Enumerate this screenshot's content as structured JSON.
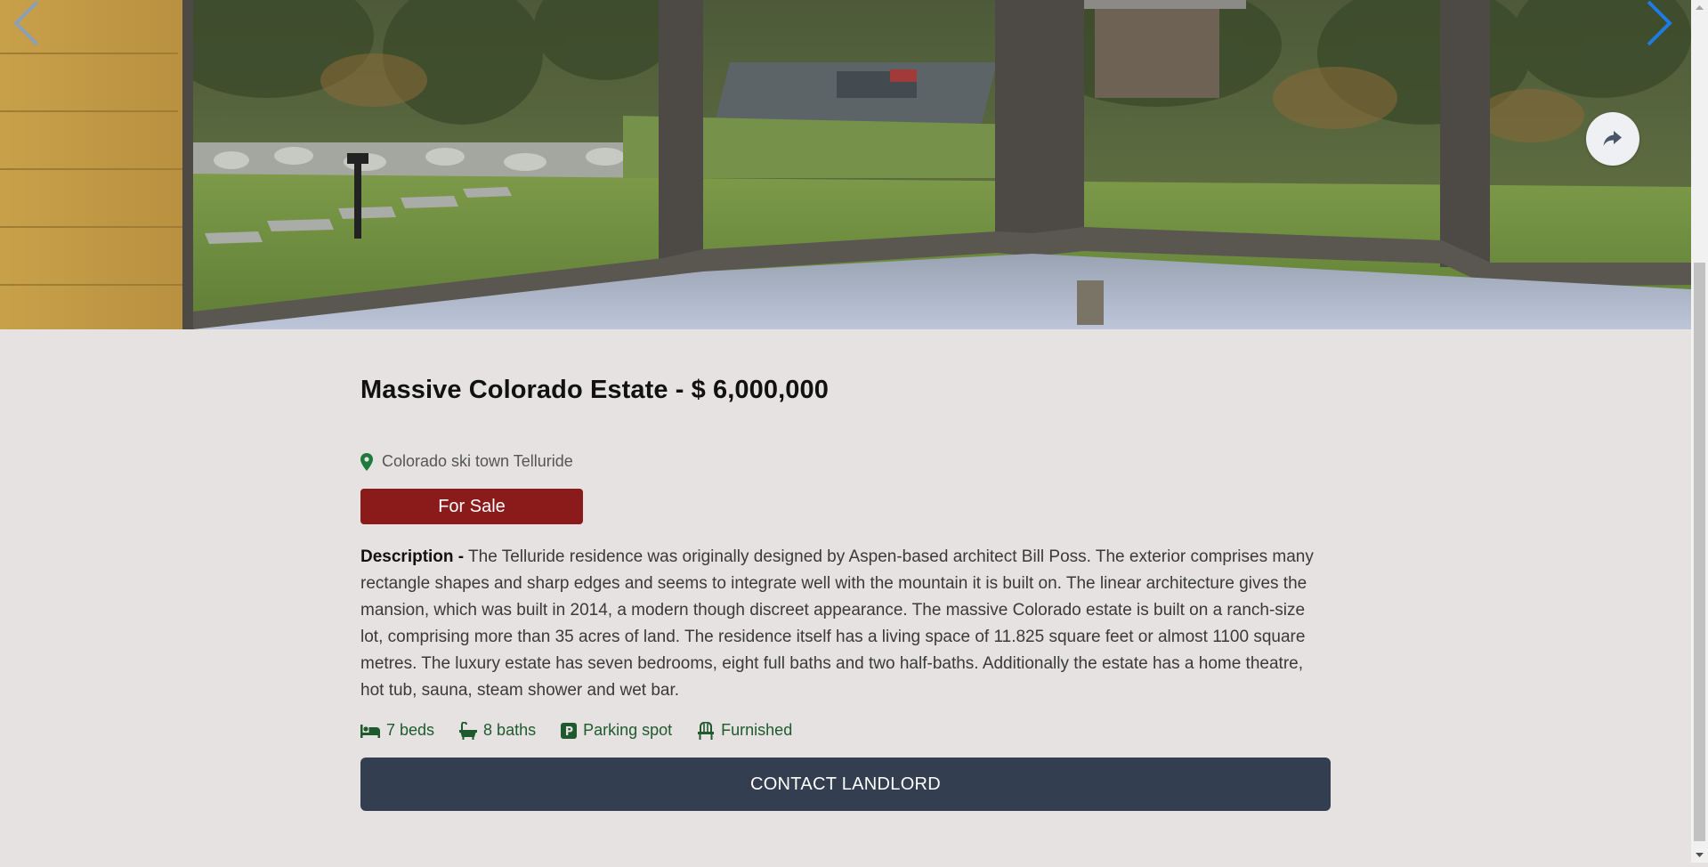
{
  "listing": {
    "title": "Massive Colorado Estate - $ 6,000,000",
    "location": "Colorado ski town Telluride",
    "status": "For Sale",
    "description_label": "Description -",
    "description_text": " The Telluride residence was originally designed by Aspen-based architect Bill Poss. The exterior comprises many rectangle shapes and sharp edges and seems to integrate well with the mountain it is built on. The linear architecture gives the mansion, which was built in 2014, a modern though discreet appearance. The massive Colorado estate is built on a ranch-size lot, comprising more than 35 acres of land. The residence itself has a living space of 11.825 square feet or almost 1100 square metres. The luxury estate has seven bedrooms, eight full baths and two half-baths. Additionally the estate has a home theatre, hot tub, sauna, steam shower and wet bar.",
    "features": [
      {
        "icon": "bed-icon",
        "label": "7 beds"
      },
      {
        "icon": "bath-icon",
        "label": "8 baths"
      },
      {
        "icon": "parking-icon",
        "label": "Parking spot"
      },
      {
        "icon": "chair-icon",
        "label": "Furnished"
      }
    ],
    "contact_label": "CONTACT LANDLORD"
  },
  "icons": {
    "prev": "chevron-left-icon",
    "next": "chevron-right-icon",
    "share": "share-icon",
    "location": "map-pin-icon"
  },
  "colors": {
    "badge": "#8b1a1a",
    "contact_button": "#333f50",
    "feature_text": "#1f5a2e",
    "background": "#e5e2e1",
    "next_arrow": "#1e7be0"
  }
}
